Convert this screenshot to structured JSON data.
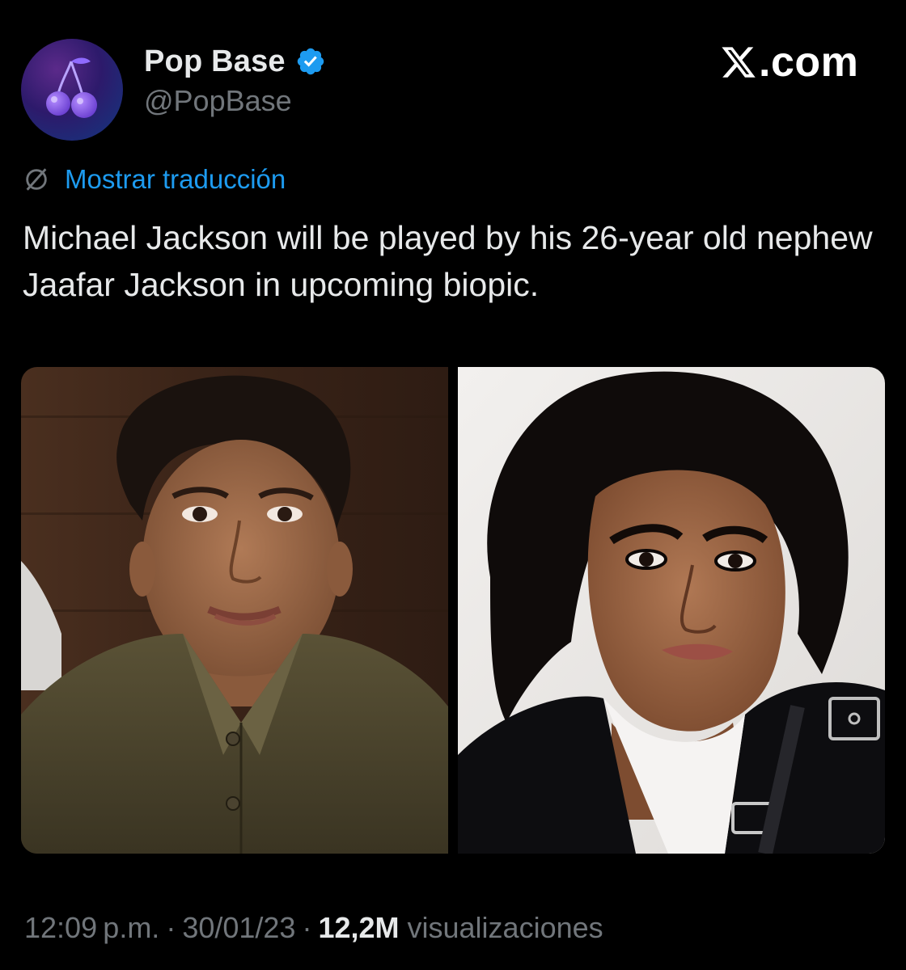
{
  "author": {
    "display_name": "Pop Base",
    "handle": "@PopBase",
    "verified": true,
    "avatar_icon": "cherry-icon",
    "verified_color": "#1d9bf0"
  },
  "brand": {
    "label": ".com",
    "icon": "x-logo-icon"
  },
  "translate": {
    "icon": "globe-slash-icon",
    "label": "Mostrar traducción",
    "color": "#1d9bf0"
  },
  "tweet": {
    "text": "Michael Jackson will be played by his 26-year old nephew Jaafar Jackson in upcoming biopic."
  },
  "media": {
    "images": [
      {
        "name": "photo-left"
      },
      {
        "name": "photo-right"
      }
    ]
  },
  "meta": {
    "time": "12:09 p.m.",
    "separator": "·",
    "date": "30/01/23",
    "views_count": "12,2M",
    "views_label": "visualizaciones"
  },
  "colors": {
    "background": "#000000",
    "text_primary": "#e7e9ea",
    "text_secondary": "#71767b",
    "accent": "#1d9bf0"
  }
}
